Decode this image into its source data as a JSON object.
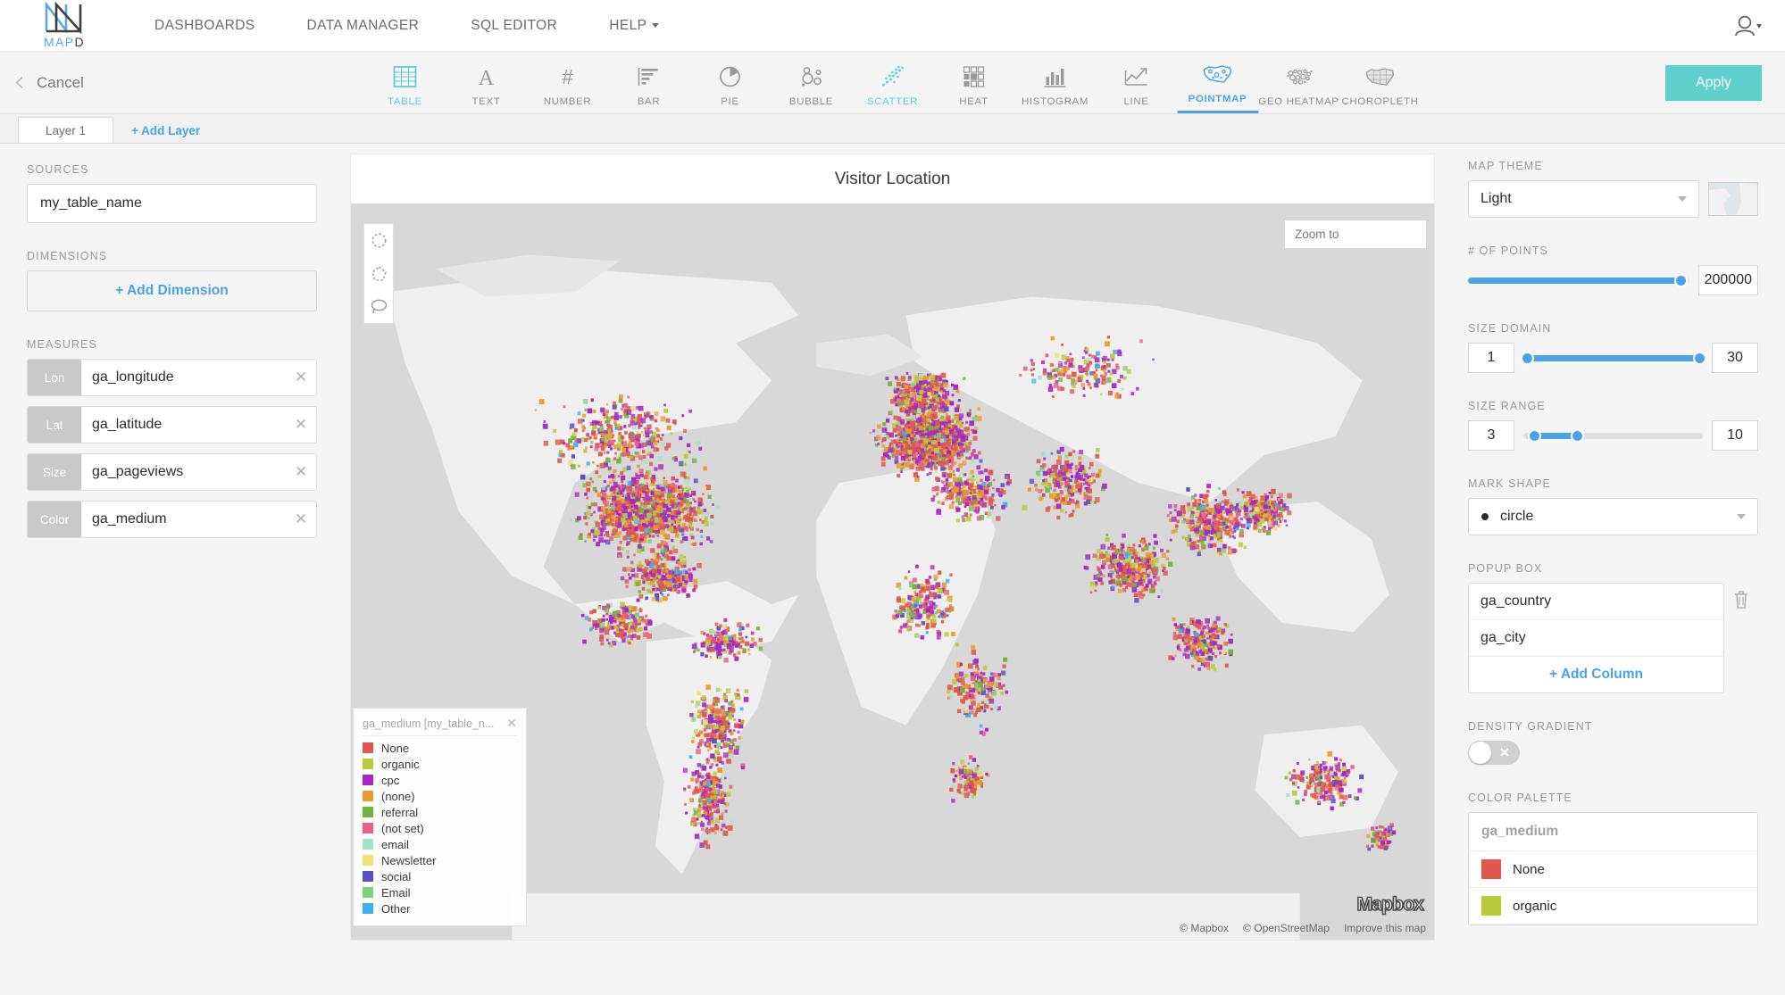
{
  "nav": {
    "logo_text_light": "MAP",
    "logo_text_dark": "D",
    "links": [
      {
        "label": "DASHBOARDS",
        "has_caret": false
      },
      {
        "label": "DATA MANAGER",
        "has_caret": false
      },
      {
        "label": "SQL EDITOR",
        "has_caret": false
      },
      {
        "label": "HELP",
        "has_caret": true
      }
    ],
    "account_icon": "user-icon"
  },
  "toolbar": {
    "cancel_label": "Cancel",
    "apply_label": "Apply",
    "active_type": "POINTMAP",
    "types": [
      {
        "label": "TABLE",
        "icon": "table-icon",
        "state": "teal"
      },
      {
        "label": "TEXT",
        "icon": "text-icon",
        "state": "normal"
      },
      {
        "label": "NUMBER",
        "icon": "number-icon",
        "state": "normal"
      },
      {
        "label": "BAR",
        "icon": "bar-chart-icon",
        "state": "normal"
      },
      {
        "label": "PIE",
        "icon": "pie-chart-icon",
        "state": "normal"
      },
      {
        "label": "BUBBLE",
        "icon": "bubble-icon",
        "state": "normal"
      },
      {
        "label": "SCATTER",
        "icon": "scatter-icon",
        "state": "teal"
      },
      {
        "label": "HEAT",
        "icon": "heat-grid-icon",
        "state": "normal"
      },
      {
        "label": "HISTOGRAM",
        "icon": "histogram-icon",
        "state": "normal"
      },
      {
        "label": "LINE",
        "icon": "line-chart-icon",
        "state": "normal"
      },
      {
        "label": "POINTMAP",
        "icon": "pointmap-icon",
        "state": "active"
      },
      {
        "label": "GEO HEATMAP",
        "icon": "geo-heatmap-icon",
        "state": "normal"
      },
      {
        "label": "CHOROPLETH",
        "icon": "choropleth-icon",
        "state": "normal"
      }
    ]
  },
  "layers": {
    "tab_label": "Layer 1",
    "add_label": "+ Add Layer"
  },
  "left_panel": {
    "sources_label": "SOURCES",
    "source_value": "my_table_name",
    "dimensions_label": "DIMENSIONS",
    "add_dimension_label": "+ Add Dimension",
    "measures_label": "MEASURES",
    "measures": [
      {
        "badge": "Lon",
        "value": "ga_longitude"
      },
      {
        "badge": "Lat",
        "value": "ga_latitude"
      },
      {
        "badge": "Size",
        "value": "ga_pageviews"
      },
      {
        "badge": "Color",
        "value": "ga_medium"
      }
    ]
  },
  "map": {
    "title": "Visitor Location",
    "zoom_to_placeholder": "Zoom to",
    "tools": [
      {
        "icon": "draw-circle-icon"
      },
      {
        "icon": "draw-polygon-icon"
      },
      {
        "icon": "draw-lasso-icon"
      }
    ],
    "legend": {
      "title": "ga_medium [my_table_n...",
      "close_icon": "close-icon",
      "items": [
        {
          "label": "None",
          "color": "#e2574c"
        },
        {
          "label": "organic",
          "color": "#b9cb3a"
        },
        {
          "label": "cpc",
          "color": "#a626c7"
        },
        {
          "label": "(none)",
          "color": "#ec9a29"
        },
        {
          "label": "referral",
          "color": "#71b33c"
        },
        {
          "label": "(not set)",
          "color": "#e86186"
        },
        {
          "label": "email",
          "color": "#a5e3c8"
        },
        {
          "label": "Newsletter",
          "color": "#f0e17a"
        },
        {
          "label": "social",
          "color": "#5b4fc4"
        },
        {
          "label": "Email",
          "color": "#7ed47e"
        },
        {
          "label": "Other",
          "color": "#3ab0ef"
        }
      ]
    },
    "brand": "Mapbox",
    "attribution": [
      "© Mapbox",
      "© OpenStreetMap",
      "Improve this map"
    ]
  },
  "right_panel": {
    "map_theme_label": "MAP THEME",
    "map_theme_value": "Light",
    "points_label": "# OF POINTS",
    "points_value": "200000",
    "points_pct": 96,
    "size_domain_label": "SIZE DOMAIN",
    "size_domain_min": "1",
    "size_domain_max": "30",
    "size_domain_lo_pct": 2,
    "size_domain_hi_pct": 98,
    "size_range_label": "SIZE RANGE",
    "size_range_min": "3",
    "size_range_max": "10",
    "size_range_lo_pct": 6,
    "size_range_hi_pct": 30,
    "mark_shape_label": "MARK SHAPE",
    "mark_shape_value": "circle",
    "popup_box_label": "POPUP BOX",
    "popup_columns": [
      "ga_country",
      "ga_city"
    ],
    "add_column_label": "+ Add Column",
    "delete_icon": "trash-icon",
    "density_gradient_label": "DENSITY GRADIENT",
    "density_gradient_on": false,
    "color_palette_label": "COLOR PALETTE",
    "palette_field": "ga_medium",
    "palette_items": [
      {
        "label": "None",
        "color": "#e2574c"
      },
      {
        "label": "organic",
        "color": "#b9cb3a"
      }
    ]
  },
  "colors": {
    "accent_blue": "#4aa3e8",
    "accent_teal": "#5ed0cb",
    "ocean": "#d8d8d8",
    "land": "#efefef"
  }
}
